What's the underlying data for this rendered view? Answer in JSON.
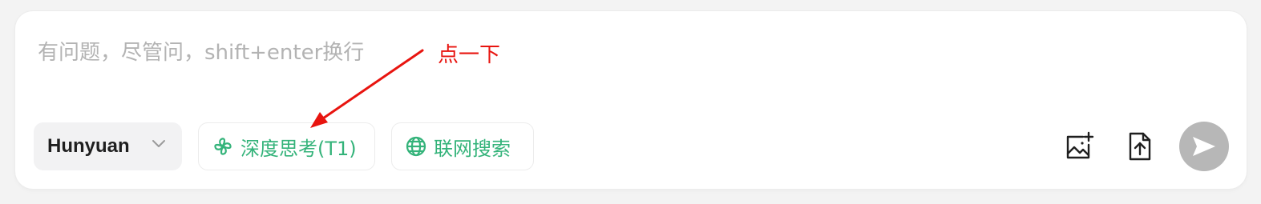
{
  "input": {
    "placeholder": "有问题，尽管问，shift+enter换行",
    "value": ""
  },
  "toolbar": {
    "model_label": "Hunyuan",
    "deep_think_label": "深度思考(T1)",
    "web_search_label": "联网搜索"
  },
  "annotation": {
    "text": "点一下"
  },
  "colors": {
    "accent_green": "#34b37a",
    "annotation_red": "#e8140f",
    "send_button_disabled": "#b7b7b7"
  },
  "icons": {
    "model_dropdown": "chevron-down-icon",
    "deep_think": "clover-icon",
    "web_search": "globe-icon",
    "image_upload": "image-add-icon",
    "file_upload": "file-upload-icon",
    "send": "send-icon"
  }
}
